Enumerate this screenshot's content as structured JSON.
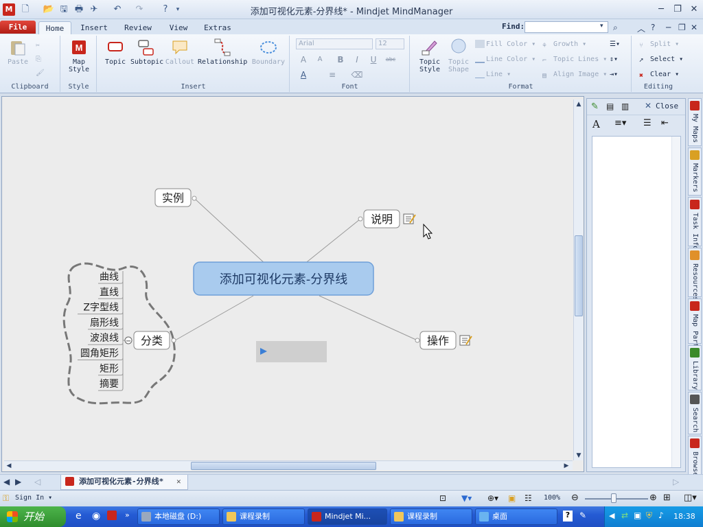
{
  "window": {
    "title": "添加可视化元素-分界线* - Mindjet MindManager",
    "app_logo": "M"
  },
  "tabs": {
    "file": "File",
    "items": [
      "Home",
      "Insert",
      "Review",
      "View",
      "Extras"
    ]
  },
  "find": {
    "label": "Find:"
  },
  "ribbon": {
    "clipboard": {
      "group": "Clipboard",
      "paste": "Paste"
    },
    "style": {
      "group": "Style",
      "map_style_1": "Map",
      "map_style_2": "Style"
    },
    "insert": {
      "group": "Insert",
      "topic": "Topic",
      "subtopic": "Subtopic",
      "callout": "Callout",
      "relationship": "Relationship",
      "boundary": "Boundary"
    },
    "font": {
      "group": "Font",
      "font_name": "Arial",
      "font_size": "12",
      "bold": "B",
      "italic": "I",
      "underline": "U",
      "strike": "abc"
    },
    "format": {
      "group": "Format",
      "topic_style_1": "Topic",
      "topic_style_2": "Style",
      "topic_shape_1": "Topic",
      "topic_shape_2": "Shape",
      "fill_color": "Fill Color",
      "line_color": "Line Color",
      "line": "Line",
      "growth": "Growth",
      "topic_lines": "Topic Lines",
      "align_image": "Align Image"
    },
    "editing": {
      "group": "Editing",
      "split": "Split",
      "select": "Select",
      "clear": "Clear"
    }
  },
  "map": {
    "central": "添加可视化元素-分界线",
    "topics": {
      "example": "实例",
      "explain": "说明",
      "operate": "操作",
      "category": "分类"
    },
    "subtopics": [
      "曲线",
      "直线",
      "Z字型线",
      "扇形线",
      "波浪线",
      "圆角矩形",
      "矩形",
      "摘要"
    ],
    "collapse_symbol": "−"
  },
  "pane": {
    "close": "Close"
  },
  "side_tabs": [
    "My Maps",
    "Markers",
    "Task Info",
    "Resources",
    "Map Parts",
    "Library",
    "Search",
    "Browser"
  ],
  "doc_tab": "添加可视化元素-分界线*",
  "status": {
    "sign_in": "Sign In",
    "zoom": "100%"
  },
  "taskbar": {
    "start": "开始",
    "buttons": [
      "本地磁盘 (D:)",
      "课程录制",
      "Mindjet Mi...",
      "课程录制",
      "桌面"
    ],
    "clock": "18:38"
  },
  "colors": {
    "central_fill": "#a9cbee",
    "accent_red": "#c8261c",
    "taskbar_blue": "#245bd4",
    "boundary": "#777777"
  }
}
